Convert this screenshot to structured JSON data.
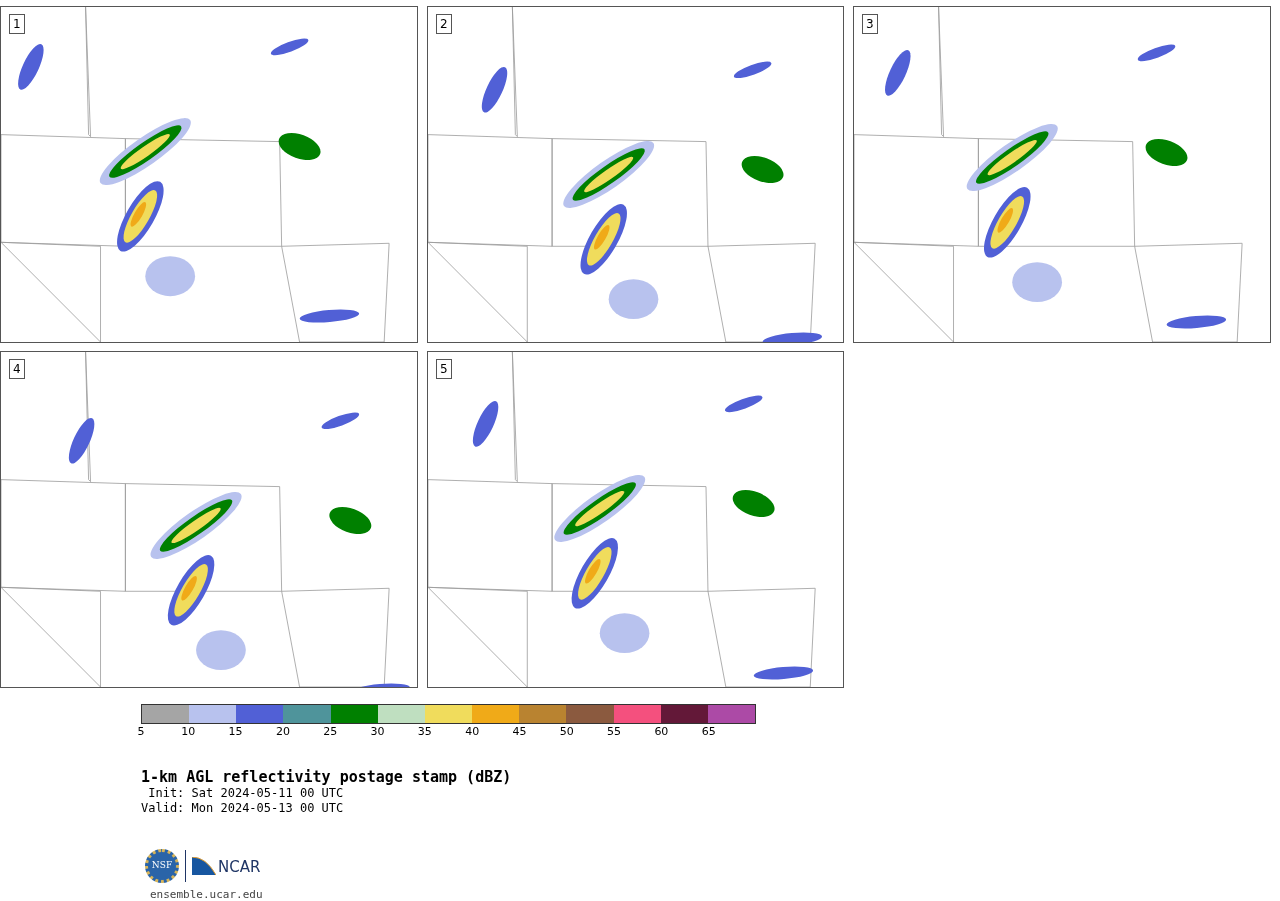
{
  "panels": [
    {
      "label": "1"
    },
    {
      "label": "2"
    },
    {
      "label": "3"
    },
    {
      "label": "4"
    },
    {
      "label": "5"
    }
  ],
  "colorbar": {
    "segments": [
      {
        "color": "#a5a5a5"
      },
      {
        "color": "#b8c2ee"
      },
      {
        "color": "#5160d6"
      },
      {
        "color": "#4f949b"
      },
      {
        "color": "#008000"
      },
      {
        "color": "#bfdfc0"
      },
      {
        "color": "#f0dc5c"
      },
      {
        "color": "#f0aa18"
      },
      {
        "color": "#b98330"
      },
      {
        "color": "#8b5a3f"
      },
      {
        "color": "#f4507e"
      },
      {
        "color": "#631838"
      },
      {
        "color": "#ac4aa6"
      }
    ],
    "ticks": [
      "5",
      "10",
      "15",
      "20",
      "25",
      "30",
      "35",
      "40",
      "45",
      "50",
      "55",
      "60",
      "65"
    ]
  },
  "title": "1-km AGL reflectivity postage stamp (dBZ)",
  "init": " Init: Sat 2024-05-11 00 UTC",
  "valid": "Valid: Mon 2024-05-13 00 UTC",
  "logo": {
    "left": "NSF",
    "right": "NCAR"
  },
  "footer_link": "ensemble.ucar.edu"
}
